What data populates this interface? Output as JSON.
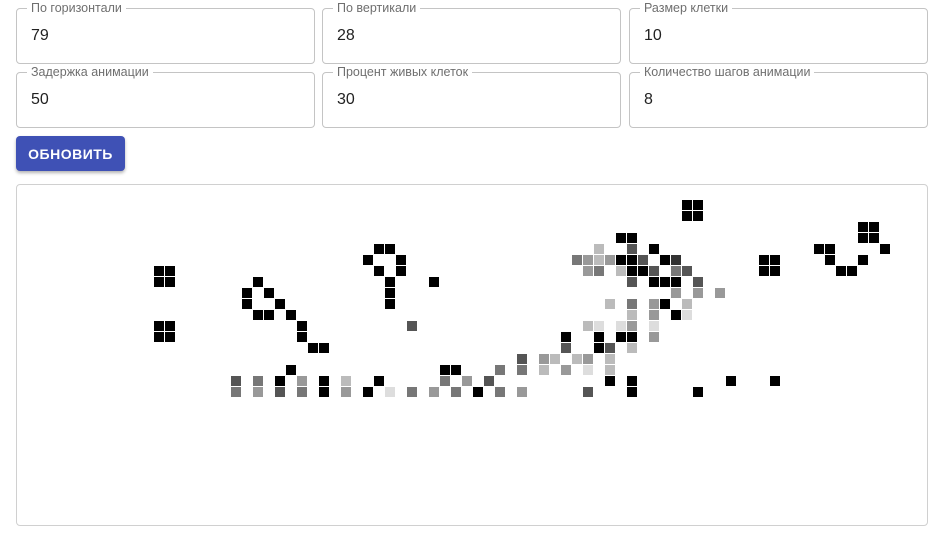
{
  "fields": [
    {
      "label": "По горизонтали",
      "value": "79"
    },
    {
      "label": "По вертикали",
      "value": "28"
    },
    {
      "label": "Размер клетки",
      "value": "10"
    },
    {
      "label": "Задержка анимации",
      "value": "50"
    },
    {
      "label": "Процент живых клеток",
      "value": "30"
    },
    {
      "label": "Количество шагов анимации",
      "value": "8"
    }
  ],
  "refresh_label": "ОБНОВИТЬ",
  "colors": {
    "accent": "#3f51b5",
    "cell_shades": [
      "#000000",
      "#333333",
      "#555555",
      "#777777",
      "#999999",
      "#bbbbbb",
      "#dddddd"
    ]
  },
  "board_rows": [
    "...............................................................................",
    "..................................................00...........................",
    "..................................................00...........................",
    "..................................................................00...........",
    "............................................00....................00...........",
    "......................00..................5..2.0..............00....0..........",
    ".....................0..0...............3454002.01.......00....0..0............",
    "..00..................0.0................43.5002.32......00.....00.............",
    "..00.......0...........0...0.................2.000.2....................................",
    "..........0.0..........0.........................4.4.4..........................",
    "..........0..0.........0...................5.3.40.5.............................",
    "...........00.0..............................5.4.06.............................",
    "..00...........0.........2...............56.64.6..........",
    "..00...........0.......................0..0.00.4...........................",
    "................00.....................2..02.5...........................",
    "...................................2.45.54.5..........................",
    "..............0.............00...3.3.5.4.6.5.......................",
    ".........2.3.0.4.0.5..0.....3.4.2..........0.0........0...0....",
    ".........3.4.2.3.0.4.0.6.3.4.3.0.3.4.....2...0.....0.............",
    "...............................................................",
    "...............................................................",
    "...............................................................",
    "...............................................................",
    "...............................................................",
    "...............................................................",
    "...............................................................",
    "...............................................................",
    "..............................................................."
  ]
}
